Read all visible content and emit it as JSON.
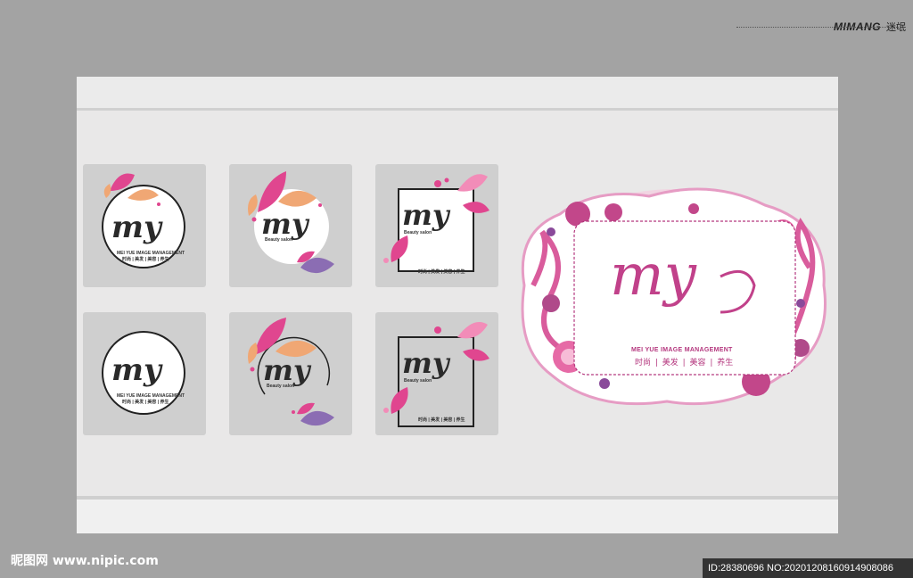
{
  "header": {
    "brand_name": "MIMANG",
    "brand_cn": "迷氓"
  },
  "logos": {
    "my": "my",
    "beauty_salon": "Beauty salon",
    "en_small": "MEI YUE IMAGE MANAGEMENT",
    "tagline_small": "时尚 | 美发 | 美容 | 养生"
  },
  "feature": {
    "my": "my",
    "en": "MEI YUE IMAGE MANAGEMENT",
    "cn": "时尚 | 美发 | 美容 | 养生"
  },
  "watermark": {
    "site": "昵图网 www.nipic.com",
    "id_text": "ID:28380696 NO:20201208160914908086"
  },
  "colors": {
    "background": "#a3a3a3",
    "wall": "#e9e8e8",
    "tile": "#cfcfcf",
    "pink": "#e0468f",
    "magenta": "#b4377e",
    "orange": "#f0a774",
    "purple": "#8b6db3"
  }
}
